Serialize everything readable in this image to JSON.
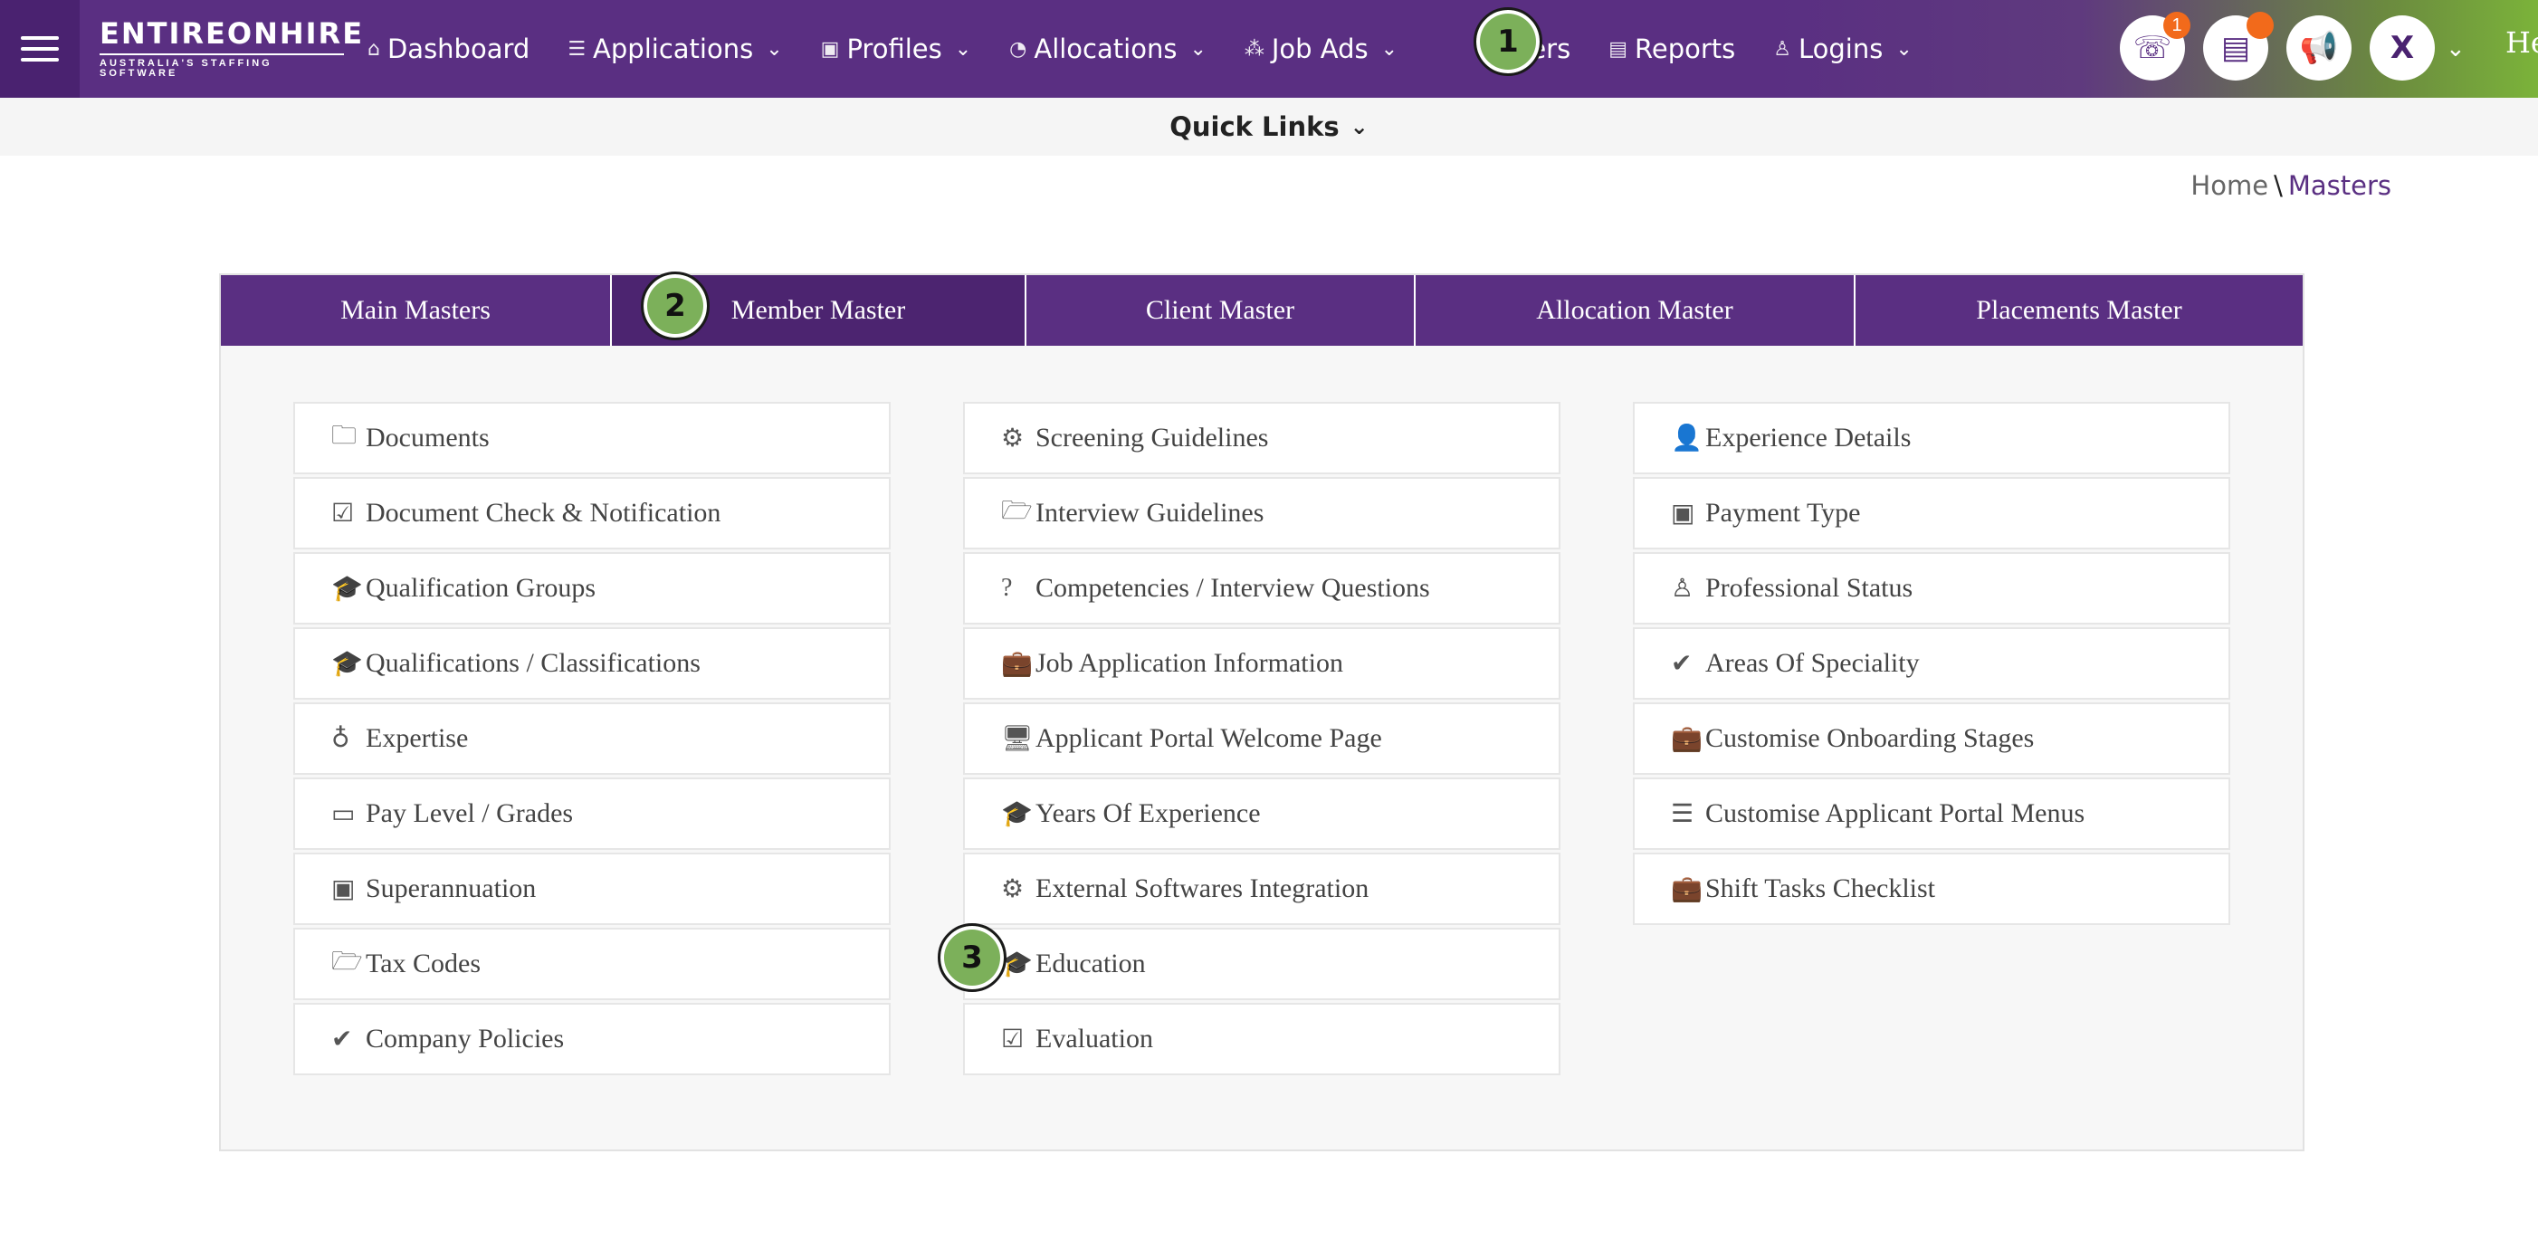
{
  "brand": {
    "name": "ENTIREONHIRE",
    "tagline": "AUSTRALIA'S STAFFING SOFTWARE"
  },
  "nav": {
    "items": [
      {
        "label": "Dashboard",
        "icon": "home-icon",
        "glyph": "⌂",
        "dropdown": false
      },
      {
        "label": "Applications",
        "icon": "list-icon",
        "glyph": "☰",
        "dropdown": true
      },
      {
        "label": "Profiles",
        "icon": "profile-icon",
        "glyph": "▣",
        "dropdown": true
      },
      {
        "label": "Allocations",
        "icon": "pie-icon",
        "glyph": "◔",
        "dropdown": true
      },
      {
        "label": "Job Ads",
        "icon": "network-icon",
        "glyph": "⁂",
        "dropdown": true
      },
      {
        "label": "Masters",
        "icon": "masters-icon",
        "glyph": "",
        "dropdown": false
      },
      {
        "label": "Reports",
        "icon": "report-icon",
        "glyph": "▤",
        "dropdown": false
      },
      {
        "label": "Logins",
        "icon": "user-icon",
        "glyph": "♙",
        "dropdown": true
      }
    ],
    "masters_visible": "asters",
    "right": {
      "call_badge": "1",
      "user_initial": "X",
      "truncated_text": "He"
    }
  },
  "quick_links": {
    "label": "Quick Links"
  },
  "breadcrumb": {
    "home": "Home",
    "separator": "\\",
    "current": "Masters"
  },
  "tabs": [
    {
      "label": "Main Masters"
    },
    {
      "label": "Member Master"
    },
    {
      "label": "Client Master"
    },
    {
      "label": "Allocation Master"
    },
    {
      "label": "Placements Master"
    }
  ],
  "columns": [
    [
      {
        "label": "Documents",
        "icon": "folder-icon",
        "glyph": "🗀"
      },
      {
        "label": "Document Check & Notification",
        "icon": "checkbox-icon",
        "glyph": "☑"
      },
      {
        "label": "Qualification Groups",
        "icon": "graduation-cap-icon",
        "glyph": "🎓"
      },
      {
        "label": "Qualifications / Classifications",
        "icon": "graduation-cap-icon",
        "glyph": "🎓"
      },
      {
        "label": "Expertise",
        "icon": "lightbulb-icon",
        "glyph": "♁"
      },
      {
        "label": "Pay Level / Grades",
        "icon": "credit-card-icon",
        "glyph": "▭"
      },
      {
        "label": "Superannuation",
        "icon": "money-icon",
        "glyph": "▣"
      },
      {
        "label": "Tax Codes",
        "icon": "folder-open-icon",
        "glyph": "🗁"
      },
      {
        "label": "Company Policies",
        "icon": "check-circle-icon",
        "glyph": "✔"
      }
    ],
    [
      {
        "label": "Screening Guidelines",
        "icon": "gears-icon",
        "glyph": "⚙"
      },
      {
        "label": "Interview Guidelines",
        "icon": "folder-open-icon",
        "glyph": "🗁"
      },
      {
        "label": "Competencies / Interview Questions",
        "icon": "question-circle-icon",
        "glyph": "?"
      },
      {
        "label": "Job Application Information",
        "icon": "briefcase-icon",
        "glyph": "💼"
      },
      {
        "label": "Applicant Portal Welcome Page",
        "icon": "desktop-icon",
        "glyph": "🖥"
      },
      {
        "label": "Years Of Experience",
        "icon": "graduation-cap-icon",
        "glyph": "🎓"
      },
      {
        "label": "External Softwares Integration",
        "icon": "gear-icon",
        "glyph": "⚙"
      },
      {
        "label": "Education",
        "icon": "graduation-cap-icon",
        "glyph": "🎓"
      },
      {
        "label": "Evaluation",
        "icon": "checkbox-icon",
        "glyph": "☑"
      }
    ],
    [
      {
        "label": "Experience Details",
        "icon": "user-icon",
        "glyph": "👤"
      },
      {
        "label": "Payment Type",
        "icon": "money-icon",
        "glyph": "▣"
      },
      {
        "label": "Professional Status",
        "icon": "user-outline-icon",
        "glyph": "♙"
      },
      {
        "label": "Areas Of Speciality",
        "icon": "check-icon",
        "glyph": "✔"
      },
      {
        "label": "Customise Onboarding Stages",
        "icon": "briefcase-icon",
        "glyph": "💼"
      },
      {
        "label": "Customise Applicant Portal Menus",
        "icon": "bars-icon",
        "glyph": "☰"
      },
      {
        "label": "Shift Tasks Checklist",
        "icon": "briefcase-icon",
        "glyph": "💼"
      }
    ]
  ],
  "steps": [
    "1",
    "2",
    "3"
  ],
  "colors": {
    "primary": "#5a2f82",
    "active_tab": "#4c2470",
    "badge": "#f26a1b",
    "step": "#7cb05a"
  }
}
